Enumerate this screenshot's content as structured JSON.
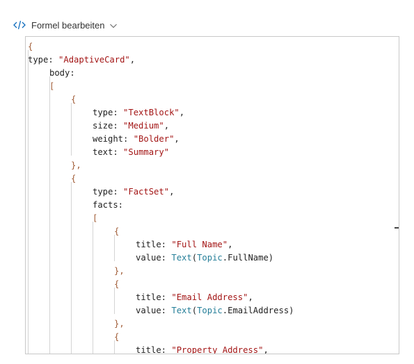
{
  "toolbar": {
    "icon": "code-icon",
    "title": "Formel bearbeiten",
    "dropdown_icon": "chevron-down-icon"
  },
  "editor": {
    "lines": [
      {
        "tokens": [
          {
            "t": "{",
            "c": "brace"
          }
        ]
      },
      {
        "tokens": [
          {
            "t": "type: ",
            "c": "key"
          },
          {
            "t": "\"AdaptiveCard\"",
            "c": "str"
          },
          {
            "t": ",",
            "c": "key"
          }
        ]
      },
      {
        "tokens": [
          {
            "t": "body:",
            "c": "key"
          }
        ]
      },
      {
        "tokens": [
          {
            "t": "[",
            "c": "brace"
          }
        ]
      },
      {
        "tokens": [
          {
            "t": "{",
            "c": "brace"
          }
        ]
      },
      {
        "tokens": [
          {
            "t": "type: ",
            "c": "key"
          },
          {
            "t": "\"TextBlock\"",
            "c": "str"
          },
          {
            "t": ",",
            "c": "key"
          }
        ]
      },
      {
        "tokens": [
          {
            "t": "size: ",
            "c": "key"
          },
          {
            "t": "\"Medium\"",
            "c": "str"
          },
          {
            "t": ",",
            "c": "key"
          }
        ]
      },
      {
        "tokens": [
          {
            "t": "weight: ",
            "c": "key"
          },
          {
            "t": "\"Bolder\"",
            "c": "str"
          },
          {
            "t": ",",
            "c": "key"
          }
        ]
      },
      {
        "tokens": [
          {
            "t": "text: ",
            "c": "key"
          },
          {
            "t": "\"Summary\"",
            "c": "str"
          }
        ]
      },
      {
        "tokens": [
          {
            "t": "},",
            "c": "brace"
          }
        ]
      },
      {
        "tokens": [
          {
            "t": "{",
            "c": "brace"
          }
        ]
      },
      {
        "tokens": [
          {
            "t": "type: ",
            "c": "key"
          },
          {
            "t": "\"FactSet\"",
            "c": "str"
          },
          {
            "t": ",",
            "c": "key"
          }
        ]
      },
      {
        "tokens": [
          {
            "t": "facts:",
            "c": "key"
          }
        ]
      },
      {
        "tokens": [
          {
            "t": "[",
            "c": "brace"
          }
        ]
      },
      {
        "tokens": [
          {
            "t": "{",
            "c": "brace"
          }
        ]
      },
      {
        "tokens": [
          {
            "t": "title: ",
            "c": "key"
          },
          {
            "t": "\"Full Name\"",
            "c": "str"
          },
          {
            "t": ",",
            "c": "key"
          }
        ]
      },
      {
        "tokens": [
          {
            "t": "value: ",
            "c": "key"
          },
          {
            "t": "Text",
            "c": "fn"
          },
          {
            "t": "(",
            "c": "key"
          },
          {
            "t": "Topic",
            "c": "fn"
          },
          {
            "t": ".FullName)",
            "c": "key"
          }
        ]
      },
      {
        "tokens": [
          {
            "t": "},",
            "c": "brace"
          }
        ]
      },
      {
        "tokens": [
          {
            "t": "{",
            "c": "brace"
          }
        ]
      },
      {
        "tokens": [
          {
            "t": "title: ",
            "c": "key"
          },
          {
            "t": "\"Email Address\"",
            "c": "str"
          },
          {
            "t": ",",
            "c": "key"
          }
        ]
      },
      {
        "tokens": [
          {
            "t": "value: ",
            "c": "key"
          },
          {
            "t": "Text",
            "c": "fn"
          },
          {
            "t": "(",
            "c": "key"
          },
          {
            "t": "Topic",
            "c": "fn"
          },
          {
            "t": ".EmailAddress)",
            "c": "key"
          }
        ]
      },
      {
        "tokens": [
          {
            "t": "},",
            "c": "brace"
          }
        ]
      },
      {
        "tokens": [
          {
            "t": "{",
            "c": "brace"
          }
        ]
      },
      {
        "tokens": [
          {
            "t": "title: ",
            "c": "key"
          },
          {
            "t": "\"Property Address\"",
            "c": "str"
          },
          {
            "t": ",",
            "c": "key"
          }
        ]
      }
    ]
  }
}
